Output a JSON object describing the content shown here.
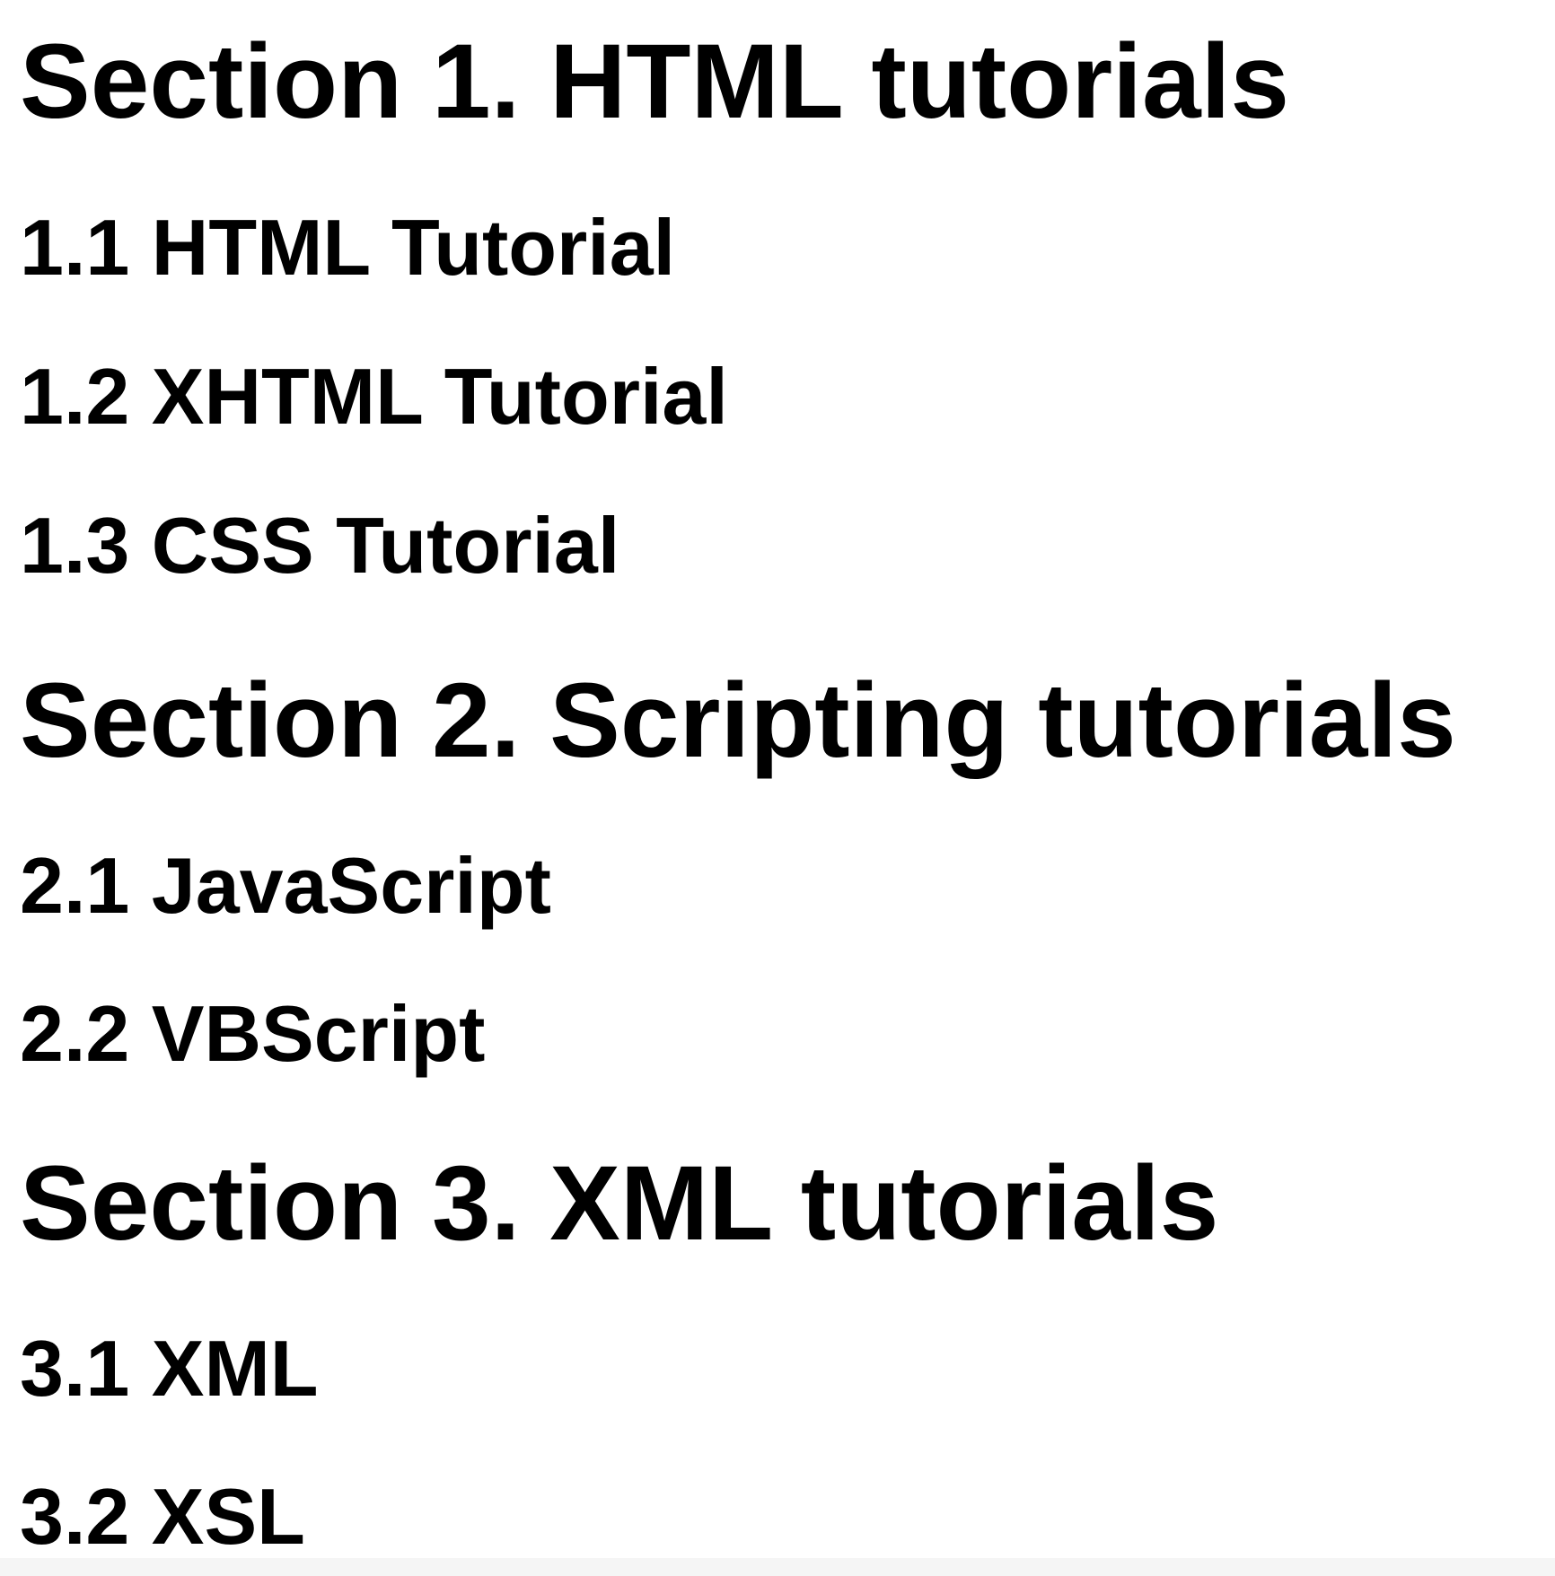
{
  "sections": [
    {
      "heading": "Section 1. HTML tutorials",
      "items": [
        "1.1 HTML Tutorial",
        "1.2 XHTML Tutorial",
        "1.3 CSS Tutorial"
      ]
    },
    {
      "heading": "Section 2. Scripting tutorials",
      "items": [
        "2.1 JavaScript",
        "2.2 VBScript"
      ]
    },
    {
      "heading": "Section 3. XML tutorials",
      "items": [
        "3.1 XML",
        "3.2 XSL"
      ]
    }
  ]
}
